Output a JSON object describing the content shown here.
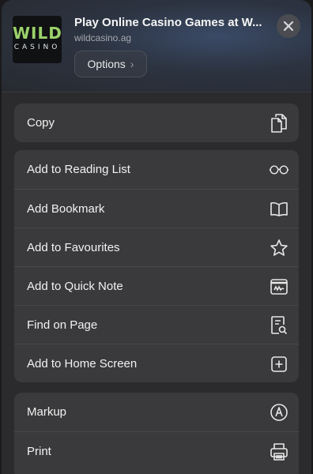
{
  "header": {
    "logo": {
      "line1": "WILD",
      "line2": "CASINO"
    },
    "title": "Play Online Casino Games at W...",
    "domain": "wildcasino.ag",
    "options_label": "Options"
  },
  "groups": [
    {
      "items": [
        {
          "label": "Copy",
          "icon": "copy-icon"
        }
      ]
    },
    {
      "items": [
        {
          "label": "Add to Reading List",
          "icon": "glasses-icon"
        },
        {
          "label": "Add Bookmark",
          "icon": "book-icon"
        },
        {
          "label": "Add to Favourites",
          "icon": "star-icon"
        },
        {
          "label": "Add to Quick Note",
          "icon": "quick-note-icon"
        },
        {
          "label": "Find on Page",
          "icon": "find-doc-icon"
        },
        {
          "label": "Add to Home Screen",
          "icon": "add-square-icon"
        }
      ]
    },
    {
      "items": [
        {
          "label": "Markup",
          "icon": "markup-pen-icon"
        },
        {
          "label": "Print",
          "icon": "printer-icon"
        }
      ]
    }
  ]
}
